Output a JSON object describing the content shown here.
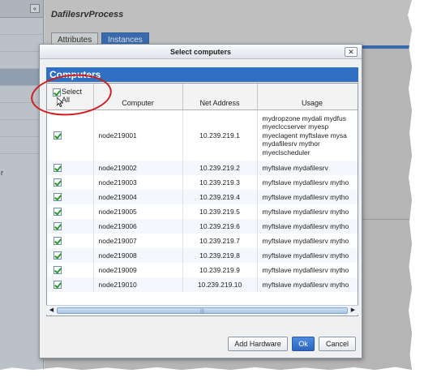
{
  "background_app": {
    "left_fragment": "r",
    "collapse_glyph": "«",
    "process_title": "DafilesrvProcess",
    "tabs": [
      {
        "label": "Attributes",
        "active": false
      },
      {
        "label": "Instances",
        "active": true
      }
    ]
  },
  "dialog": {
    "title": "Select computers",
    "close_glyph": "✕",
    "section_title": "Computers",
    "columns": {
      "select_all_line1": "Select",
      "select_all_line2": "All",
      "computer": "Computer",
      "net_address": "Net Address",
      "usage": "Usage"
    },
    "rows": [
      {
        "checked": true,
        "computer": "node219001",
        "address": "10.239.219.1",
        "usage_lines": [
          "mydropzone mydali mydfus",
          "myeclccserver myesp",
          "myeclagent myftslave mysa",
          "mydafilesrv mythor",
          "myeclscheduler"
        ]
      },
      {
        "checked": true,
        "computer": "node219002",
        "address": "10.239.219.2",
        "usage": "myftslave mydafilesrv"
      },
      {
        "checked": true,
        "computer": "node219003",
        "address": "10.239.219.3",
        "usage": "myftslave mydafilesrv mytho"
      },
      {
        "checked": true,
        "computer": "node219004",
        "address": "10.239.219.4",
        "usage": "myftslave mydafilesrv mytho"
      },
      {
        "checked": true,
        "computer": "node219005",
        "address": "10.239.219.5",
        "usage": "myftslave mydafilesrv mytho"
      },
      {
        "checked": true,
        "computer": "node219006",
        "address": "10.239.219.6",
        "usage": "myftslave mydafilesrv mytho"
      },
      {
        "checked": true,
        "computer": "node219007",
        "address": "10.239.219.7",
        "usage": "myftslave mydafilesrv mytho"
      },
      {
        "checked": true,
        "computer": "node219008",
        "address": "10.239.219.8",
        "usage": "myftslave mydafilesrv mytho"
      },
      {
        "checked": true,
        "computer": "node219009",
        "address": "10.239.219.9",
        "usage": "myftslave mydafilesrv mytho"
      },
      {
        "checked": true,
        "computer": "node219010",
        "address": "10.239.219.10",
        "usage": "myftslave mydafilesrv mytho"
      }
    ],
    "scroll": {
      "left_glyph": "◀",
      "right_glyph": "▶",
      "grip_glyph": "|||"
    },
    "buttons": {
      "add_hardware": "Add Hardware",
      "ok": "Ok",
      "cancel": "Cancel"
    }
  },
  "colors": {
    "accent": "#2f6fc4",
    "annotation": "#cc1f1f",
    "check": "#2a9a2a"
  }
}
